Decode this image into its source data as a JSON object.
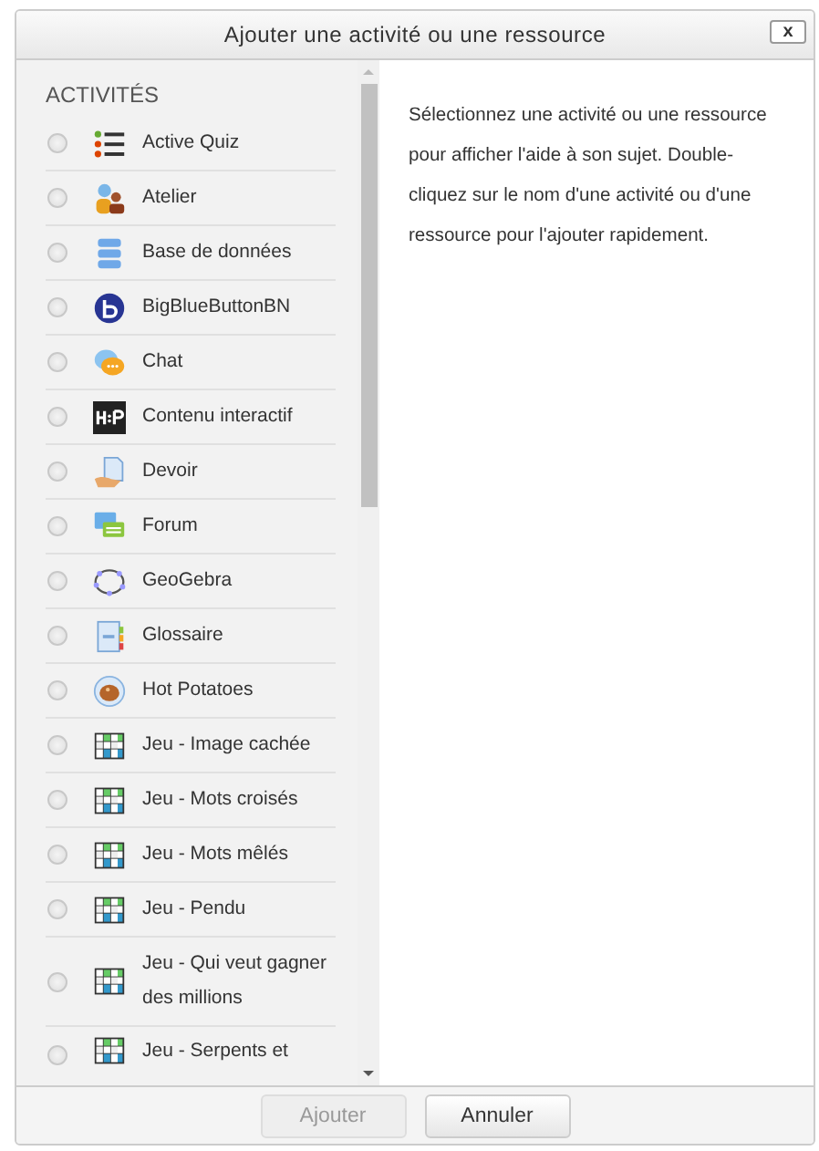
{
  "dialog": {
    "title": "Ajouter une activité ou une ressource",
    "close_label": "x"
  },
  "section_heading": "ACTIVITÉS",
  "items": [
    {
      "label": "Active Quiz",
      "selected": false
    },
    {
      "label": "Atelier",
      "selected": false
    },
    {
      "label": "Base de données",
      "selected": false
    },
    {
      "label": "BigBlueButtonBN",
      "selected": false
    },
    {
      "label": "Chat",
      "selected": false
    },
    {
      "label": "Contenu interactif",
      "selected": false
    },
    {
      "label": "Devoir",
      "selected": false
    },
    {
      "label": "Forum",
      "selected": false
    },
    {
      "label": "GeoGebra",
      "selected": false
    },
    {
      "label": "Glossaire",
      "selected": false
    },
    {
      "label": "Hot Potatoes",
      "selected": false
    },
    {
      "label": "Jeu - Image cachée",
      "selected": false
    },
    {
      "label": "Jeu - Mots croisés",
      "selected": false
    },
    {
      "label": "Jeu - Mots mêlés",
      "selected": false
    },
    {
      "label": "Jeu - Pendu",
      "selected": false
    },
    {
      "label": "Jeu - Qui veut gagner des millions",
      "selected": false
    },
    {
      "label": "Jeu - Serpents et",
      "selected": false
    }
  ],
  "help_text": "Sélectionnez une activité ou une ressource pour afficher l'aide à son sujet. Double-cliquez sur le nom d'une activité ou d'une ressource pour l'ajouter rapidement.",
  "buttons": [
    {
      "label": "Ajouter",
      "disabled": true
    },
    {
      "label": "Annuler",
      "disabled": false
    }
  ]
}
